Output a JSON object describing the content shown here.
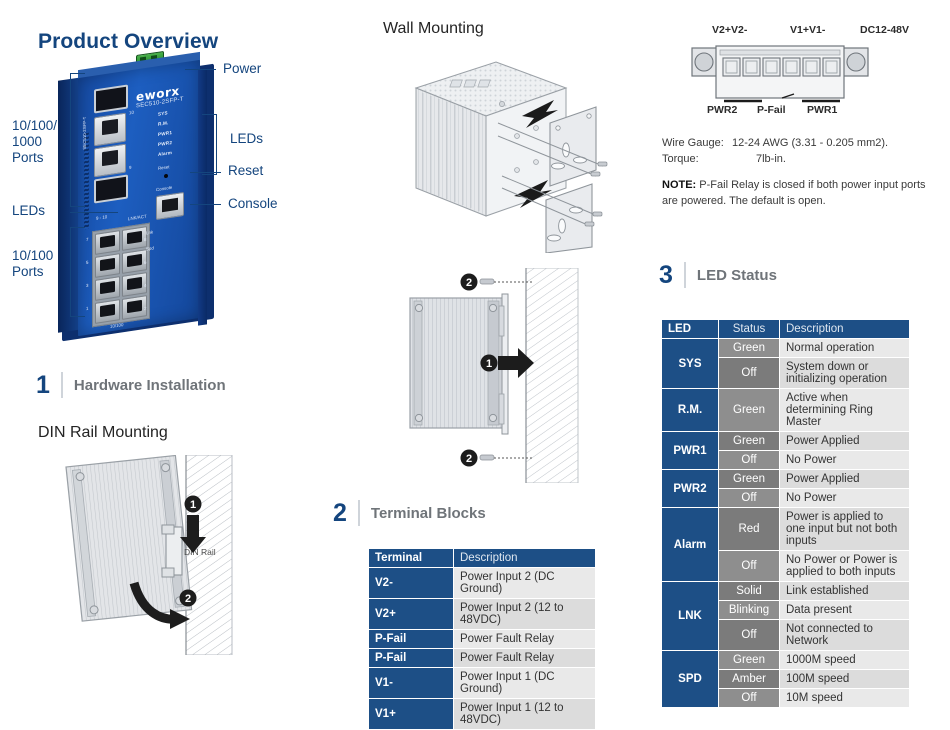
{
  "product_overview": {
    "title": "Product Overview",
    "device": {
      "brand": "eworx",
      "model": "SEC510-2SFP-T",
      "side_text": "SEC510-2SFP-T",
      "led_labels": [
        "SYS",
        "R.M.",
        "PWR1",
        "PWR2",
        "Alarm"
      ],
      "reset_label": "Reset",
      "console_label": "Console",
      "sfp_port_numbers": [
        "10",
        "9"
      ],
      "lnk_act_label": "LNK/ACT",
      "lnk_label": "Lnk",
      "spd_label": "Spd",
      "port_row_label": "9  -  10",
      "bottom_label": "10/100",
      "port_numbers": [
        "7",
        "8",
        "5",
        "6",
        "3",
        "4",
        "1",
        "2"
      ]
    },
    "callouts_left": [
      {
        "label": "10/100/\n1000\nPorts"
      },
      {
        "label": "LEDs"
      },
      {
        "label": "10/100\nPorts"
      }
    ],
    "callouts_right": [
      {
        "label": "Power"
      },
      {
        "label": "LEDs"
      },
      {
        "label": "Reset"
      },
      {
        "label": "Console"
      }
    ]
  },
  "sections": {
    "hardware_installation": {
      "number": "1",
      "label": "Hardware Installation"
    },
    "terminal_blocks": {
      "number": "2",
      "label": "Terminal Blocks"
    },
    "led_status": {
      "number": "3",
      "label": "LED Status"
    }
  },
  "din_rail": {
    "heading": "DIN Rail Mounting",
    "rail_label": "DIN Rail",
    "steps": [
      "1",
      "2"
    ]
  },
  "wall_mounting": {
    "heading": "Wall Mounting",
    "steps_top": [],
    "steps_bottom": [
      "1",
      "2",
      "2"
    ]
  },
  "terminal_block_diagram": {
    "top_labels": [
      "V2+V2-",
      "V1+V1-",
      "DC12-48V"
    ],
    "bottom_labels": [
      "PWR2",
      "P-Fail",
      "PWR1"
    ],
    "specs": [
      {
        "name": "Wire Gauge:",
        "value": "12-24 AWG (3.31 - 0.205 mm2)."
      },
      {
        "name": "Torque:",
        "value": "7lb-in."
      }
    ],
    "note_prefix": "NOTE:",
    "note_text": " P-Fail Relay is closed if both power input ports are powered. The default is open."
  },
  "terminal_table": {
    "headers": [
      "Terminal",
      "Description"
    ],
    "rows": [
      {
        "terminal": "V2-",
        "description": "Power Input 2 (DC Ground)"
      },
      {
        "terminal": "V2+",
        "description": "Power Input 2 (12 to 48VDC)"
      },
      {
        "terminal": "P-Fail",
        "description": "Power Fault Relay"
      },
      {
        "terminal": "P-Fail",
        "description": "Power Fault Relay"
      },
      {
        "terminal": "V1-",
        "description": "Power Input 1 (DC Ground)"
      },
      {
        "terminal": "V1+",
        "description": "Power Input 1 (12 to 48VDC)"
      }
    ]
  },
  "led_table": {
    "headers": [
      "LED",
      "Status",
      "Description"
    ],
    "groups": [
      {
        "led": "SYS",
        "rows": [
          {
            "status": "Green",
            "description": "Normal operation"
          },
          {
            "status": "Off",
            "description": "System down or initializing operation"
          }
        ]
      },
      {
        "led": "R.M.",
        "rows": [
          {
            "status": "Green",
            "description": "Active when determining Ring Master"
          }
        ]
      },
      {
        "led": "PWR1",
        "rows": [
          {
            "status": "Green",
            "description": "Power Applied"
          },
          {
            "status": "Off",
            "description": "No Power"
          }
        ]
      },
      {
        "led": "PWR2",
        "rows": [
          {
            "status": "Green",
            "description": "Power Applied"
          },
          {
            "status": "Off",
            "description": "No Power"
          }
        ]
      },
      {
        "led": "Alarm",
        "rows": [
          {
            "status": "Red",
            "description": "Power is applied to one input but not both inputs"
          },
          {
            "status": "Off",
            "description": "No Power or Power is applied to both inputs"
          }
        ]
      },
      {
        "led": "LNK",
        "rows": [
          {
            "status": "Solid",
            "description": "Link established"
          },
          {
            "status": "Blinking",
            "description": "Data present"
          },
          {
            "status": "Off",
            "description": "Not connected to Network"
          }
        ]
      },
      {
        "led": "SPD",
        "rows": [
          {
            "status": "Green",
            "description": "1000M speed"
          },
          {
            "status": "Amber",
            "description": "100M speed"
          },
          {
            "status": "Off",
            "description": "10M speed"
          }
        ]
      }
    ]
  },
  "colors": {
    "brand_blue": "#14457e",
    "table_header_blue": "#1d4f86",
    "status_gray_dark": "#7b7b7b",
    "status_gray_light": "#8e8e8e",
    "desc_light": "#e9e9e9",
    "desc_alt": "#dcdcdc",
    "section_label_gray": "#6f7479"
  }
}
